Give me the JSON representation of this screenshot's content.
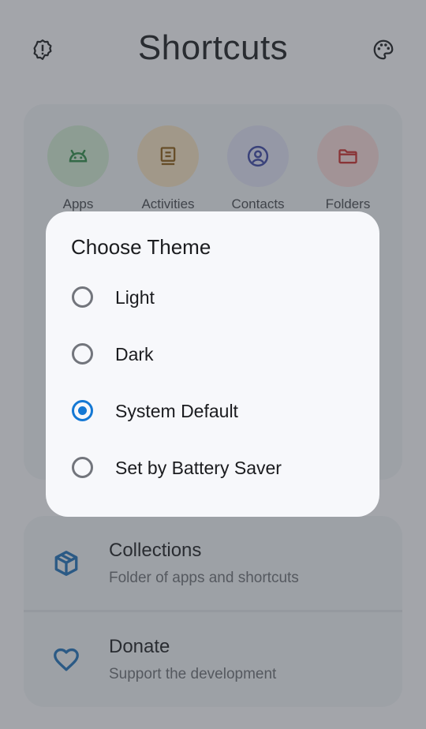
{
  "header": {
    "title": "Shortcuts",
    "left_icon": "settings-gear-icon",
    "right_icon": "palette-icon"
  },
  "shortcuts": [
    {
      "label": "Apps",
      "icon": "android-icon",
      "bg": "#cfead2",
      "color": "#2e8b47"
    },
    {
      "label": "Activities",
      "icon": "book-icon",
      "bg": "#f5e1c0",
      "color": "#8a5a12"
    },
    {
      "label": "Contacts",
      "icon": "account-icon",
      "bg": "#dfe0f5",
      "color": "#3a44a5"
    },
    {
      "label": "Folders",
      "icon": "folder-icon",
      "bg": "#f6d8d8",
      "color": "#c92a2a"
    }
  ],
  "list": [
    {
      "title": "Collections",
      "subtitle": "Folder of apps and shortcuts",
      "icon": "cube-icon"
    },
    {
      "title": "Donate",
      "subtitle": "Support the development",
      "icon": "heart-icon"
    }
  ],
  "dialog": {
    "title": "Choose Theme",
    "options": [
      {
        "label": "Light",
        "selected": false
      },
      {
        "label": "Dark",
        "selected": false
      },
      {
        "label": "System Default",
        "selected": true
      },
      {
        "label": "Set by Battery Saver",
        "selected": false
      }
    ]
  },
  "colors": {
    "accent": "#1478d4",
    "list_icon": "#1e6fb8"
  }
}
